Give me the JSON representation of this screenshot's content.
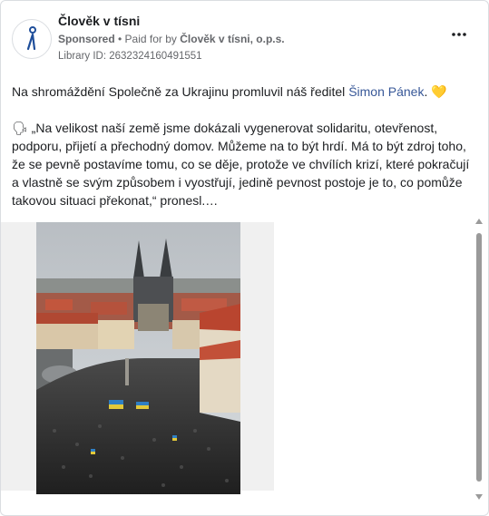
{
  "header": {
    "page_name": "Člověk v tísni",
    "sponsored_label": "Sponsored",
    "separator": " • ",
    "paid_prefix": "Paid for by ",
    "paid_by": "Člověk v tísni, o.p.s.",
    "library_id": "Library ID: 2632324160491551",
    "more_icon": "ellipsis-icon"
  },
  "post": {
    "line1_text": "Na shromáždění Společně za Ukrajinu promluvil náš ředitel ",
    "line1_link": "Šimon Pánek",
    "line1_end": ". ",
    "heart_emoji": "💛",
    "quote_emoji": "🗣",
    "quote_text": " „Na velikost naší země jsme dokázali vygenerovat solidaritu, otevřenost, podporu, přijetí a přechodný domov. Můžeme na to být hrdí. Má to být zdroj toho, že se pevně postavíme tomu, co se děje, protože ve chvílích krizí, které pokračují a vlastně se svým způsobem i vyostřují, jedině pevnost postoje je to, co pomůže takovou situaci překonat,“ pronesl.…"
  },
  "media": {
    "image_icon": "rally-photo",
    "colors": {
      "sky": "#c9ced2",
      "roofs": "#b24a36",
      "crowd": "#2a2a2a",
      "flag_blue": "#2f7fc4",
      "flag_yellow": "#e3c93a"
    }
  },
  "colors": {
    "link": "#385898",
    "muted": "#65676b",
    "border": "#dadde1"
  }
}
